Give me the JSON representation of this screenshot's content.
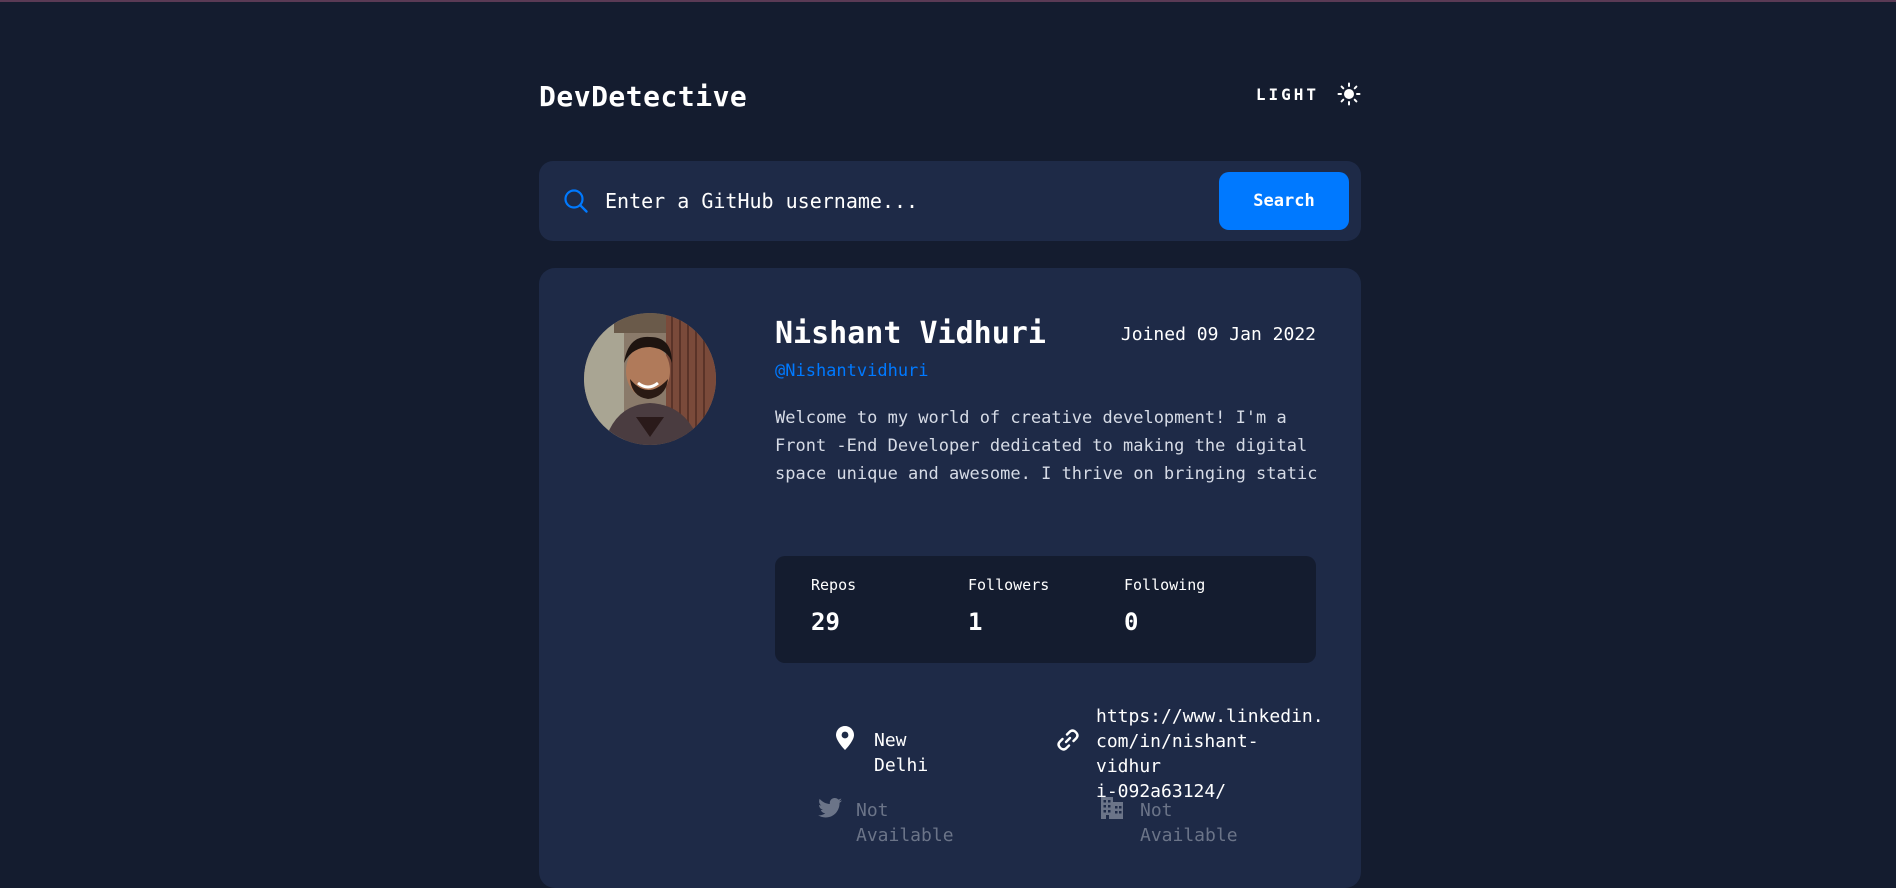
{
  "header": {
    "logo": "DevDetective",
    "theme_label": "LIGHT",
    "theme_icon": "sun-icon"
  },
  "search": {
    "placeholder": "Enter a GitHub username...",
    "button_label": "Search",
    "icon": "search-icon"
  },
  "profile": {
    "name": "Nishant Vidhuri",
    "joined": "Joined 09 Jan 2022",
    "handle": "@Nishantvidhuri",
    "bio": "Welcome to my world of creative development! I'm a Front -End Developer dedicated to making the digital space unique and awesome. I thrive on bringing static"
  },
  "stats": [
    {
      "label": "Repos",
      "value": "29"
    },
    {
      "label": "Followers",
      "value": "1"
    },
    {
      "label": "Following",
      "value": "0"
    }
  ],
  "links": {
    "location": "New Delhi",
    "website_line1": "https://www.linkedin.",
    "website_line2": "com/in/nishant-vidhur",
    "website_line3": "i-092a63124/",
    "twitter": "Not Available",
    "company": "Not Available"
  },
  "colors": {
    "background": "#141c2f",
    "card": "#1e2a47",
    "accent": "#0079ff",
    "muted": "#6b7488"
  }
}
